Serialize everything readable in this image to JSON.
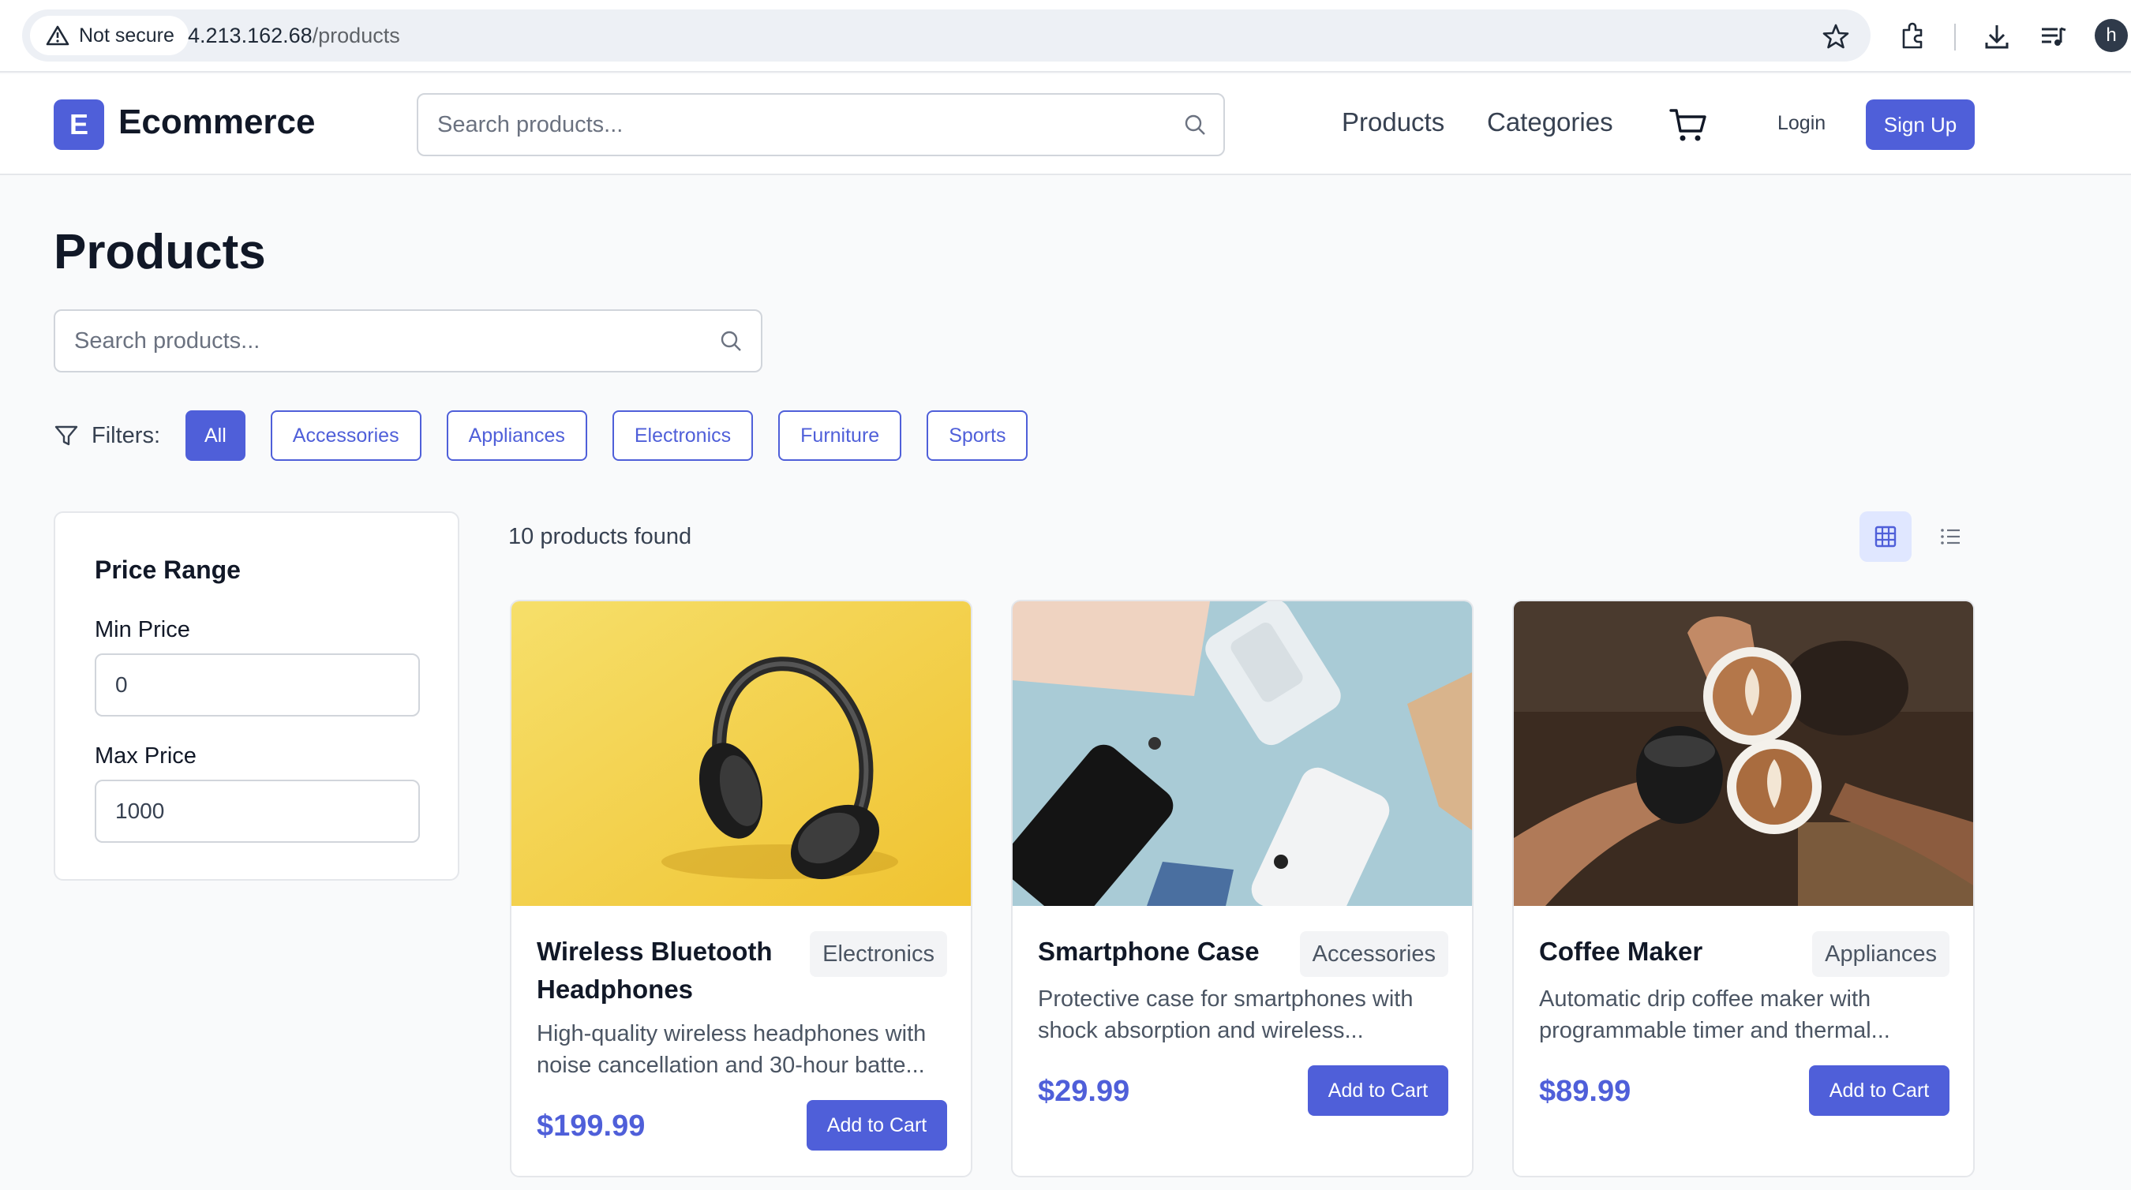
{
  "browser": {
    "security_label": "Not secure",
    "url_host": "4.213.162.68",
    "url_path": "/products",
    "profile_initial": "h"
  },
  "header": {
    "logo_letter": "E",
    "brand": "Ecommerce",
    "search_placeholder": "Search products...",
    "nav": [
      "Products",
      "Categories"
    ],
    "login_label": "Login",
    "signup_label": "Sign Up"
  },
  "page": {
    "title": "Products",
    "search_placeholder": "Search products...",
    "filters_label": "Filters:",
    "filters": [
      "All",
      "Accessories",
      "Appliances",
      "Electronics",
      "Furniture",
      "Sports"
    ],
    "active_filter": "All",
    "result_count": "10 products found"
  },
  "price_range": {
    "title": "Price Range",
    "min_label": "Min Price",
    "min_value": "0",
    "max_label": "Max Price",
    "max_value": "1000"
  },
  "products": [
    {
      "name": "Wireless Bluetooth Headphones",
      "category": "Electronics",
      "description": "High-quality wireless headphones with noise cancellation and 30-hour batte...",
      "price": "$199.99",
      "button": "Add to Cart"
    },
    {
      "name": "Smartphone Case",
      "category": "Accessories",
      "description": "Protective case for smartphones with shock absorption and wireless...",
      "price": "$29.99",
      "button": "Add to Cart"
    },
    {
      "name": "Coffee Maker",
      "category": "Appliances",
      "description": "Automatic drip coffee maker with programmable timer and thermal...",
      "price": "$89.99",
      "button": "Add to Cart"
    }
  ],
  "colors": {
    "accent": "#4f5fd9",
    "page_bg": "#f9fafb"
  }
}
